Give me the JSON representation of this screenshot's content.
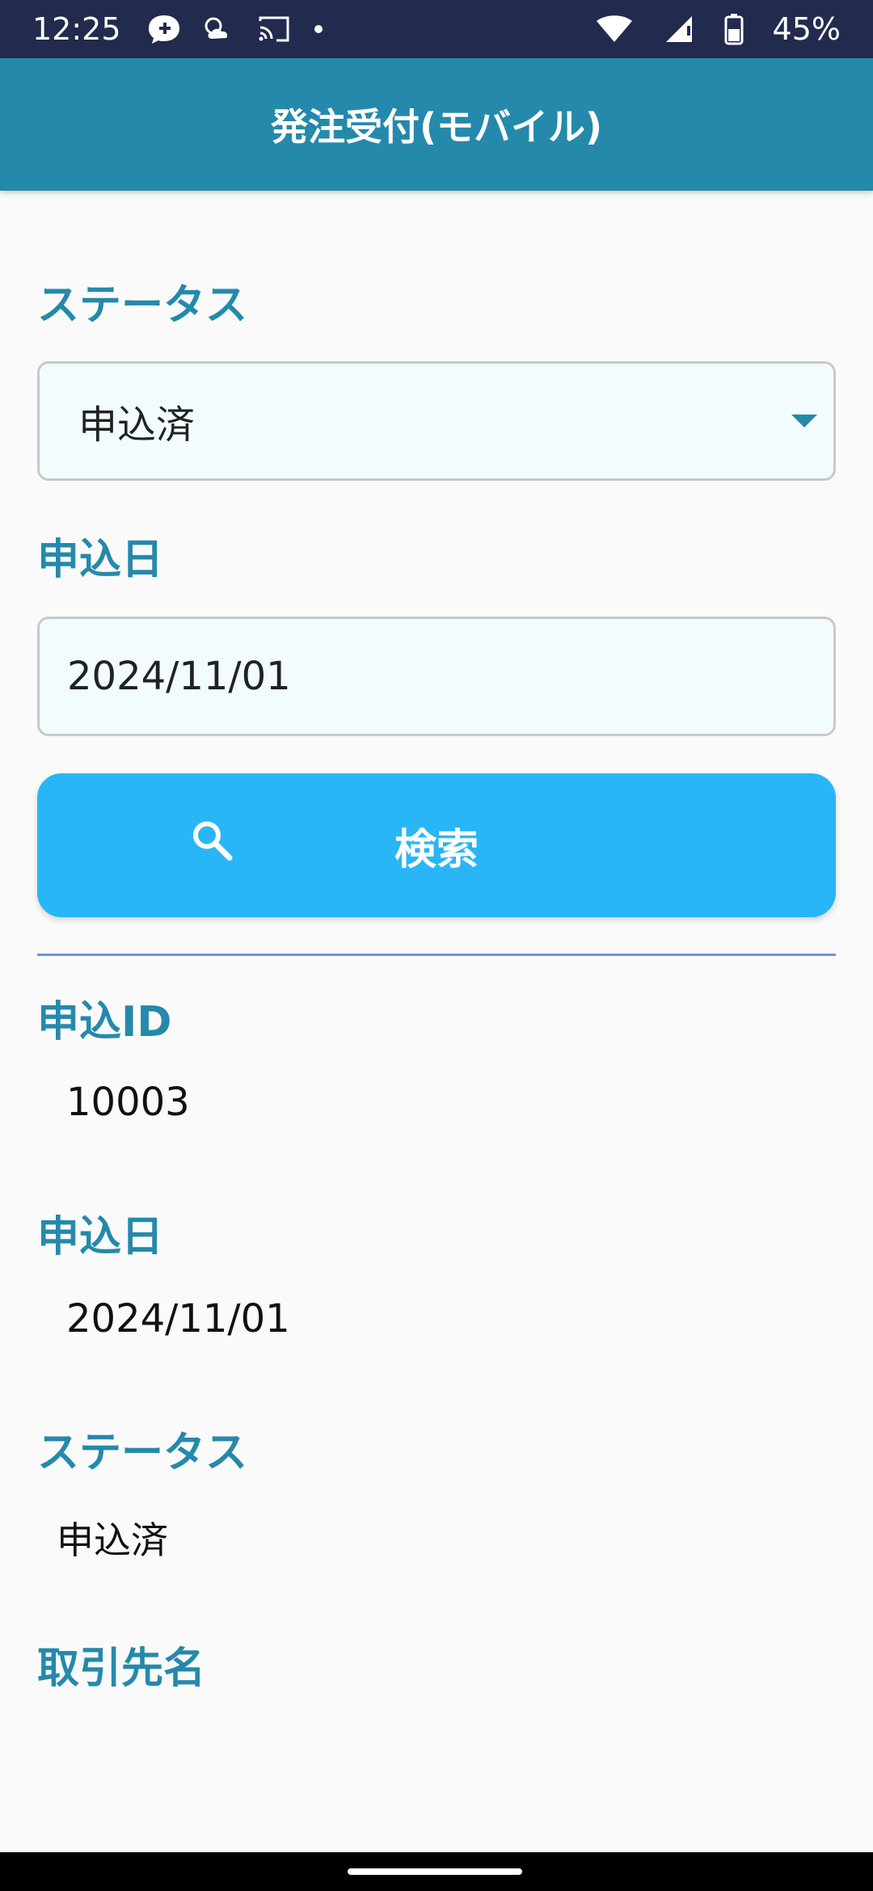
{
  "status_bar": {
    "time": "12:25",
    "battery": "45%",
    "icons": [
      "messenger-icon",
      "weather-icon",
      "cast-icon",
      "dot-icon",
      "wifi-icon",
      "signal-icon",
      "battery-icon"
    ]
  },
  "app_bar": {
    "title": "発注受付(モバイル)"
  },
  "search_form": {
    "status_label": "ステータス",
    "status_value": "申込済",
    "date_label": "申込日",
    "date_value": "2024/11/01",
    "search_button_label": "検索"
  },
  "result": {
    "id_label": "申込ID",
    "id_value": "10003",
    "date_label": "申込日",
    "date_value": "2024/11/01",
    "status_label": "ステータス",
    "status_value": "申込済",
    "customer_label": "取引先名"
  },
  "colors": {
    "app_bar": "#2589ab",
    "status_bar": "#222a4e",
    "accent_label": "#2589ab",
    "button": "#29b6f6",
    "divider": "#6a95e6"
  }
}
